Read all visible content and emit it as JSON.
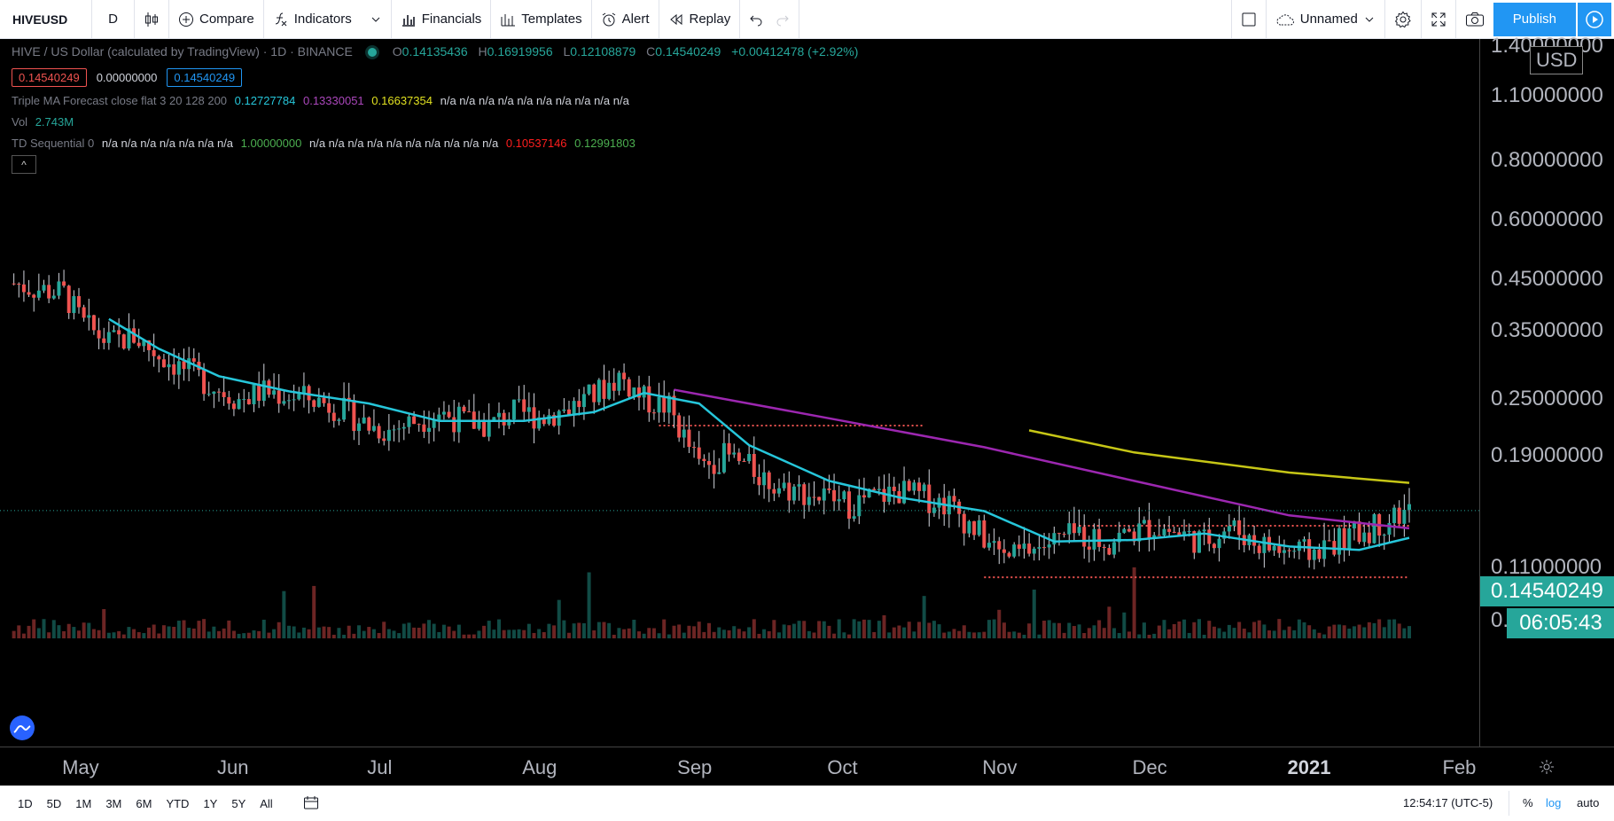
{
  "toolbar": {
    "symbol": "HIVEUSD",
    "interval": "D",
    "compare": "Compare",
    "indicators": "Indicators",
    "financials": "Financials",
    "templates": "Templates",
    "alert": "Alert",
    "replay": "Replay",
    "layout_name": "Unnamed",
    "publish": "Publish"
  },
  "legend": {
    "title": "HIVE / US Dollar (calculated by TradingView) · 1D · BINANCE",
    "open_key": "O",
    "open": "0.14135436",
    "high_key": "H",
    "high": "0.16919956",
    "low_key": "L",
    "low": "0.12108879",
    "close_key": "C",
    "close": "0.14540249",
    "change": "+0.00412478 (+2.92%)",
    "bid": "0.14540249",
    "spread": "0.00000000",
    "ask": "0.14540249",
    "ma_name": "Triple MA Forecast close flat 3 20 128 200",
    "ma_v1": "0.12727784",
    "ma_v2": "0.13330051",
    "ma_v3": "0.16637354",
    "ma_rest": "n/a n/a n/a n/a n/a n/a n/a n/a n/a n/a",
    "vol_name": "Vol",
    "vol_value": "2.743M",
    "td_name": "TD Sequential 0",
    "td_na1": "n/a n/a n/a n/a n/a n/a n/a",
    "td_v1": "1.00000000",
    "td_na2": "n/a n/a n/a n/a n/a n/a n/a n/a n/a n/a",
    "td_v2": "0.10537146",
    "td_v3": "0.12991803",
    "collapse": "^"
  },
  "price_axis": {
    "currency": "USD",
    "ticks": [
      "1.40000000",
      "1.10000000",
      "0.80000000",
      "0.60000000",
      "0.45000000",
      "0.35000000",
      "0.25000000",
      "0.19000000",
      "0.11000000",
      "0.08500000"
    ],
    "current_price": "0.14540249",
    "countdown": "06:05:43"
  },
  "time_axis": {
    "ticks": [
      "May",
      "Jun",
      "Jul",
      "Aug",
      "Sep",
      "Oct",
      "Nov",
      "Dec",
      "2021",
      "Feb"
    ]
  },
  "bottom": {
    "ranges": [
      "1D",
      "5D",
      "1M",
      "3M",
      "6M",
      "YTD",
      "1Y",
      "5Y",
      "All"
    ],
    "clock": "12:54:17 (UTC-5)",
    "percent": "%",
    "log": "log",
    "auto": "auto"
  },
  "colors": {
    "up": "#26a69a",
    "down": "#ef5350",
    "ma_fast": "#26c6da",
    "ma_mid": "#9c27b0",
    "ma_slow": "#c6c616",
    "accent": "#2196f3"
  },
  "chart_data": {
    "type": "candlestick",
    "scale": "log",
    "x_range": [
      "2020-04-20",
      "2021-02-08"
    ],
    "y_range": [
      0.075,
      1.45
    ],
    "close_series": [
      {
        "date": "2020-04-21",
        "value": 0.44
      },
      {
        "date": "2020-04-25",
        "value": 0.43
      },
      {
        "date": "2020-05-01",
        "value": 0.42
      },
      {
        "date": "2020-05-05",
        "value": 0.36
      },
      {
        "date": "2020-05-10",
        "value": 0.33
      },
      {
        "date": "2020-05-15",
        "value": 0.34
      },
      {
        "date": "2020-05-20",
        "value": 0.31
      },
      {
        "date": "2020-05-25",
        "value": 0.29
      },
      {
        "date": "2020-05-30",
        "value": 0.27
      },
      {
        "date": "2020-06-05",
        "value": 0.25
      },
      {
        "date": "2020-06-10",
        "value": 0.26
      },
      {
        "date": "2020-06-15",
        "value": 0.255
      },
      {
        "date": "2020-06-20",
        "value": 0.25
      },
      {
        "date": "2020-06-25",
        "value": 0.24
      },
      {
        "date": "2020-07-01",
        "value": 0.22
      },
      {
        "date": "2020-07-05",
        "value": 0.215
      },
      {
        "date": "2020-07-10",
        "value": 0.225
      },
      {
        "date": "2020-07-15",
        "value": 0.235
      },
      {
        "date": "2020-07-20",
        "value": 0.225
      },
      {
        "date": "2020-07-25",
        "value": 0.22
      },
      {
        "date": "2020-07-30",
        "value": 0.235
      },
      {
        "date": "2020-08-05",
        "value": 0.23
      },
      {
        "date": "2020-08-10",
        "value": 0.24
      },
      {
        "date": "2020-08-15",
        "value": 0.255
      },
      {
        "date": "2020-08-20",
        "value": 0.28
      },
      {
        "date": "2020-08-25",
        "value": 0.25
      },
      {
        "date": "2020-08-30",
        "value": 0.24
      },
      {
        "date": "2020-09-05",
        "value": 0.18
      },
      {
        "date": "2020-09-10",
        "value": 0.19
      },
      {
        "date": "2020-09-15",
        "value": 0.18
      },
      {
        "date": "2020-09-20",
        "value": 0.165
      },
      {
        "date": "2020-09-25",
        "value": 0.16
      },
      {
        "date": "2020-09-30",
        "value": 0.155
      },
      {
        "date": "2020-10-05",
        "value": 0.15
      },
      {
        "date": "2020-10-10",
        "value": 0.155
      },
      {
        "date": "2020-10-15",
        "value": 0.16
      },
      {
        "date": "2020-10-20",
        "value": 0.155
      },
      {
        "date": "2020-10-25",
        "value": 0.15
      },
      {
        "date": "2020-10-31",
        "value": 0.13
      },
      {
        "date": "2020-11-05",
        "value": 0.115
      },
      {
        "date": "2020-11-10",
        "value": 0.12
      },
      {
        "date": "2020-11-15",
        "value": 0.125
      },
      {
        "date": "2020-11-20",
        "value": 0.13
      },
      {
        "date": "2020-11-25",
        "value": 0.125
      },
      {
        "date": "2020-11-30",
        "value": 0.13
      },
      {
        "date": "2020-12-05",
        "value": 0.135
      },
      {
        "date": "2020-12-10",
        "value": 0.13
      },
      {
        "date": "2020-12-15",
        "value": 0.125
      },
      {
        "date": "2020-12-20",
        "value": 0.135
      },
      {
        "date": "2020-12-25",
        "value": 0.125
      },
      {
        "date": "2020-12-30",
        "value": 0.12
      },
      {
        "date": "2021-01-05",
        "value": 0.118
      },
      {
        "date": "2021-01-10",
        "value": 0.125
      },
      {
        "date": "2021-01-15",
        "value": 0.13
      },
      {
        "date": "2021-01-20",
        "value": 0.138
      },
      {
        "date": "2021-01-25",
        "value": 0.1454
      }
    ],
    "ma_fast_series": [
      {
        "date": "2020-05-10",
        "value": 0.37
      },
      {
        "date": "2020-05-20",
        "value": 0.32
      },
      {
        "date": "2020-06-01",
        "value": 0.28
      },
      {
        "date": "2020-06-15",
        "value": 0.26
      },
      {
        "date": "2020-07-01",
        "value": 0.245
      },
      {
        "date": "2020-07-15",
        "value": 0.225
      },
      {
        "date": "2020-08-01",
        "value": 0.225
      },
      {
        "date": "2020-08-15",
        "value": 0.235
      },
      {
        "date": "2020-08-25",
        "value": 0.258
      },
      {
        "date": "2020-09-05",
        "value": 0.245
      },
      {
        "date": "2020-09-15",
        "value": 0.2
      },
      {
        "date": "2020-10-01",
        "value": 0.168
      },
      {
        "date": "2020-10-15",
        "value": 0.155
      },
      {
        "date": "2020-11-01",
        "value": 0.145
      },
      {
        "date": "2020-11-15",
        "value": 0.125
      },
      {
        "date": "2020-12-01",
        "value": 0.126
      },
      {
        "date": "2020-12-15",
        "value": 0.13
      },
      {
        "date": "2021-01-01",
        "value": 0.122
      },
      {
        "date": "2021-01-15",
        "value": 0.12
      },
      {
        "date": "2021-01-25",
        "value": 0.1273
      }
    ],
    "ma_mid_series": [
      {
        "date": "2020-08-31",
        "value": 0.262
      },
      {
        "date": "2020-10-01",
        "value": 0.228
      },
      {
        "date": "2020-11-01",
        "value": 0.198
      },
      {
        "date": "2020-12-01",
        "value": 0.168
      },
      {
        "date": "2021-01-01",
        "value": 0.142
      },
      {
        "date": "2021-01-25",
        "value": 0.1333
      }
    ],
    "ma_slow_series": [
      {
        "date": "2020-11-10",
        "value": 0.215
      },
      {
        "date": "2020-12-01",
        "value": 0.193
      },
      {
        "date": "2021-01-01",
        "value": 0.175
      },
      {
        "date": "2021-01-25",
        "value": 0.1664
      }
    ],
    "support_lines": [
      {
        "from": "2020-08-28",
        "to": "2020-10-20",
        "value": 0.22
      },
      {
        "from": "2020-11-01",
        "to": "2021-01-25",
        "value": 0.105
      },
      {
        "from": "2020-11-20",
        "to": "2021-01-25",
        "value": 0.135
      }
    ]
  }
}
